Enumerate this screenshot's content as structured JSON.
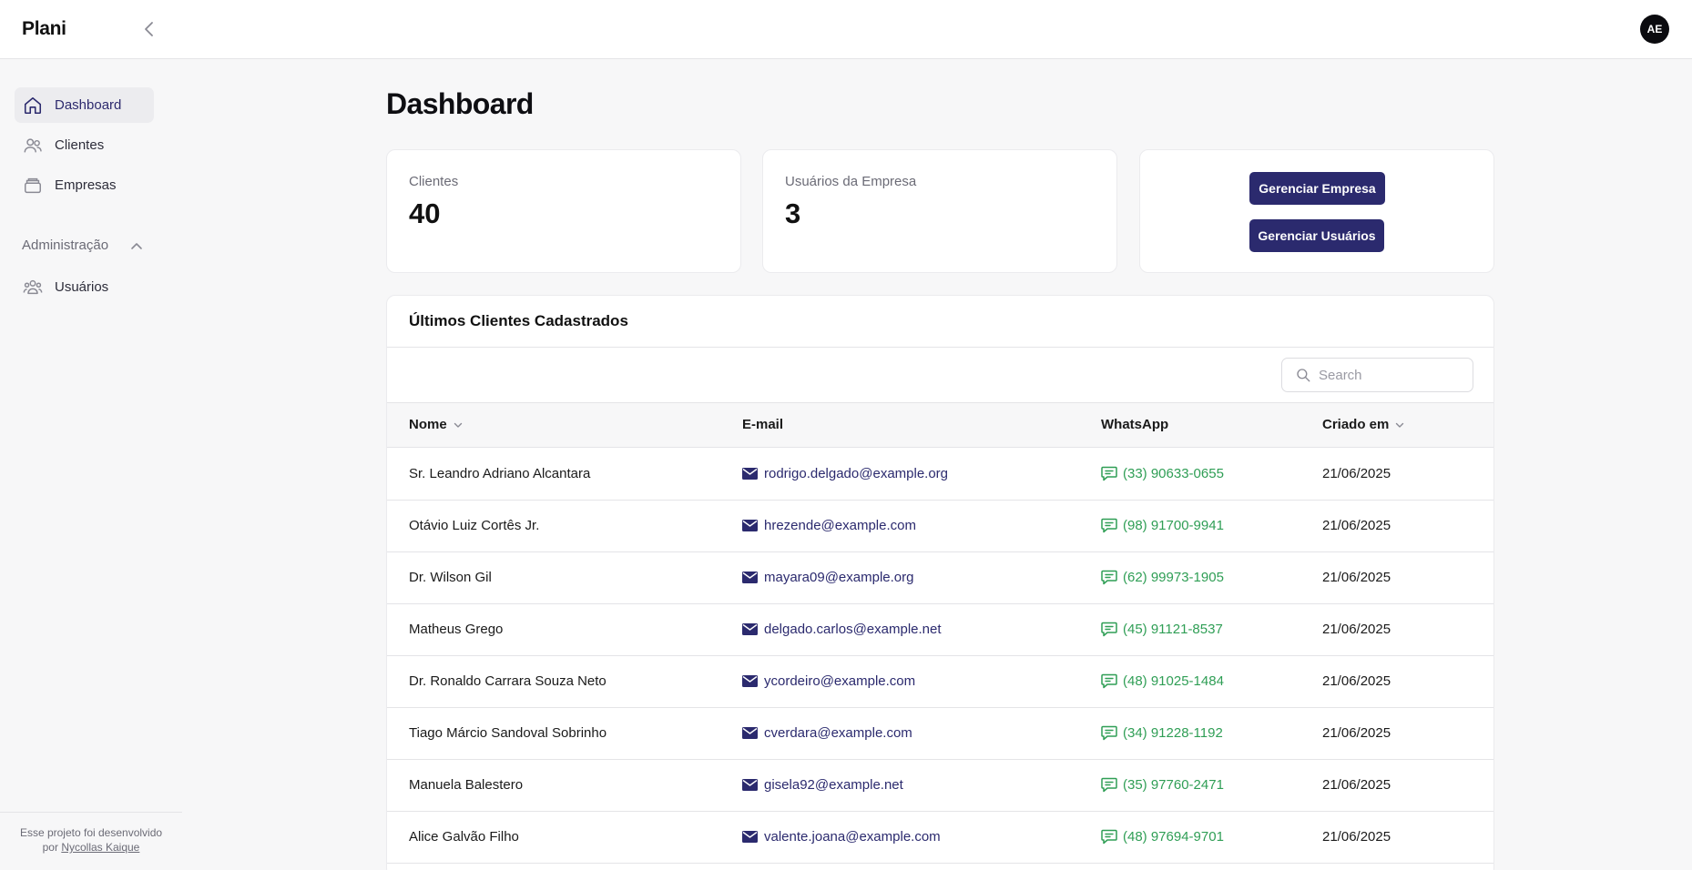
{
  "app": {
    "brand": "Plani",
    "user_initials": "AE"
  },
  "sidebar": {
    "items": [
      {
        "label": "Dashboard",
        "icon": "home-icon",
        "active": true
      },
      {
        "label": "Clientes",
        "icon": "users-icon",
        "active": false
      },
      {
        "label": "Empresas",
        "icon": "building-icon",
        "active": false
      }
    ],
    "section": {
      "label": "Administração",
      "expanded": true
    },
    "admin_items": [
      {
        "label": "Usuários",
        "icon": "users-group-icon",
        "active": false
      }
    ],
    "footer": {
      "text": "Esse projeto foi desenvolvido",
      "prefix": "por",
      "author": "Nycollas Kaique"
    }
  },
  "main": {
    "title": "Dashboard",
    "stats": [
      {
        "label": "Clientes",
        "value": "40"
      },
      {
        "label": "Usuários da Empresa",
        "value": "3"
      }
    ],
    "actions": {
      "manage_company": "Gerenciar Empresa",
      "manage_users": "Gerenciar Usuários"
    },
    "table": {
      "title": "Últimos Clientes Cadastrados",
      "search_placeholder": "Search",
      "columns": [
        "Nome",
        "E-mail",
        "WhatsApp",
        "Criado em"
      ],
      "rows": [
        {
          "name": "Sr. Leandro Adriano Alcantara",
          "email": "rodrigo.delgado@example.org",
          "whatsapp": "(33) 90633-0655",
          "created": "21/06/2025"
        },
        {
          "name": "Otávio Luiz Cortês Jr.",
          "email": "hrezende@example.com",
          "whatsapp": "(98) 91700-9941",
          "created": "21/06/2025"
        },
        {
          "name": "Dr. Wilson Gil",
          "email": "mayara09@example.org",
          "whatsapp": "(62) 99973-1905",
          "created": "21/06/2025"
        },
        {
          "name": "Matheus Grego",
          "email": "delgado.carlos@example.net",
          "whatsapp": "(45) 91121-8537",
          "created": "21/06/2025"
        },
        {
          "name": "Dr. Ronaldo Carrara Souza Neto",
          "email": "ycordeiro@example.com",
          "whatsapp": "(48) 91025-1484",
          "created": "21/06/2025"
        },
        {
          "name": "Tiago Márcio Sandoval Sobrinho",
          "email": "cverdara@example.com",
          "whatsapp": "(34) 91228-1192",
          "created": "21/06/2025"
        },
        {
          "name": "Manuela Balestero",
          "email": "gisela92@example.net",
          "whatsapp": "(35) 97760-2471",
          "created": "21/06/2025"
        },
        {
          "name": "Alice Galvão Filho",
          "email": "valente.joana@example.com",
          "whatsapp": "(48) 97694-9701",
          "created": "21/06/2025"
        }
      ]
    }
  },
  "colors": {
    "primary": "#2b2a6e",
    "whatsapp": "#2f9e55",
    "background": "#f7f7f8"
  }
}
